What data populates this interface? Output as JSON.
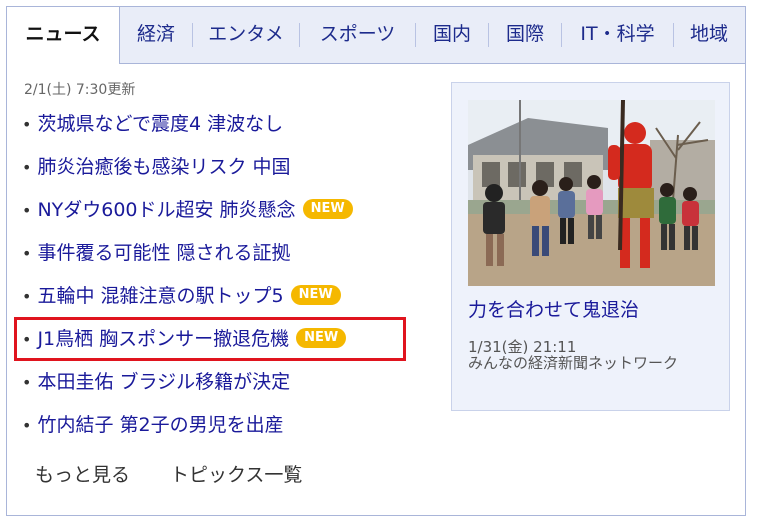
{
  "tabs": [
    "ニュース",
    "経済",
    "エンタメ",
    "スポーツ",
    "国内",
    "国際",
    "IT・科学",
    "地域"
  ],
  "updated": "2/1(土) 7:30更新",
  "news": [
    {
      "title": "茨城県などで震度4 津波なし",
      "badge": ""
    },
    {
      "title": "肺炎治癒後も感染リスク 中国",
      "badge": ""
    },
    {
      "title": "NYダウ600ドル超安 肺炎懸念",
      "badge": "NEW"
    },
    {
      "title": "事件覆る可能性 隠される証拠",
      "badge": ""
    },
    {
      "title": "五輪中 混雑注意の駅トップ5",
      "badge": "NEW"
    },
    {
      "title": "J1鳥栖 胸スポンサー撤退危機",
      "badge": "NEW"
    },
    {
      "title": "本田圭佑 ブラジル移籍が決定",
      "badge": ""
    },
    {
      "title": "竹内結子 第2子の男児を出産",
      "badge": ""
    }
  ],
  "links": {
    "more": "もっと見る",
    "topics": "トピックス一覧"
  },
  "pickup": {
    "title": "力を合わせて鬼退治",
    "date": "1/31(金) 21:11",
    "source": "みんなの経済新聞ネットワーク"
  },
  "colors": {
    "link": "#1a1a9a",
    "badge": "#f5b800",
    "highlight": "#e0141e",
    "tab_bg": "#e9edf8"
  }
}
